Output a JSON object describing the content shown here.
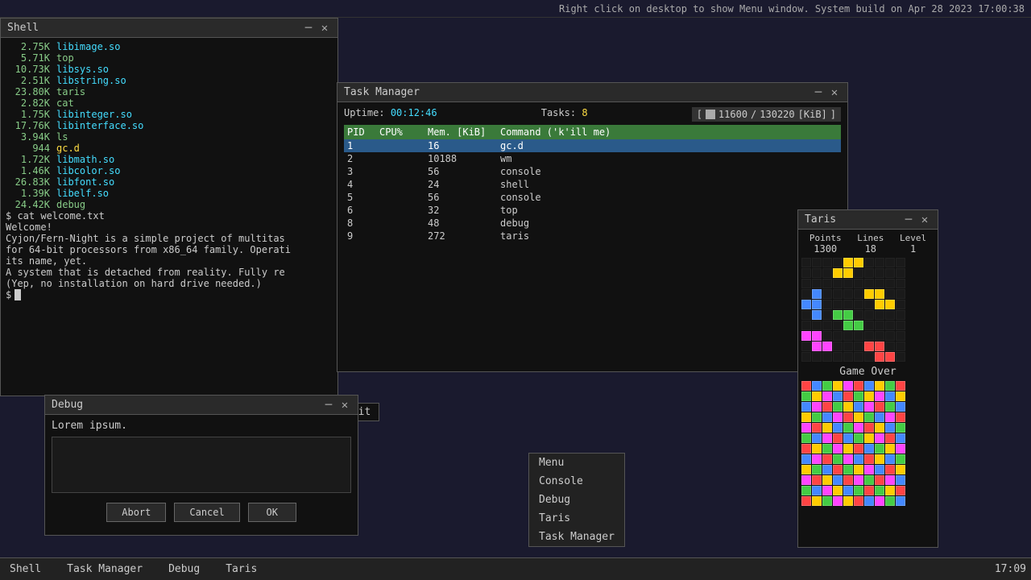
{
  "topbar": {
    "text": "Right click on desktop to show Menu window.  System build on Apr 28 2023 17:00:38"
  },
  "shell": {
    "title": "Shell",
    "lines": [
      {
        "size": "2.75K",
        "file": "libimage.so",
        "color": "cyan"
      },
      {
        "size": "5.71K",
        "file": "top",
        "color": "green"
      },
      {
        "size": "10.73K",
        "file": "libsys.so",
        "color": "cyan"
      },
      {
        "size": "2.51K",
        "file": "libstring.so",
        "color": "cyan"
      },
      {
        "size": "23.80K",
        "file": "taris",
        "color": "green"
      },
      {
        "size": "2.82K",
        "file": "cat",
        "color": "green"
      },
      {
        "size": "1.75K",
        "file": "libinteger.so",
        "color": "cyan"
      },
      {
        "size": "17.76K",
        "file": "libinterface.so",
        "color": "cyan"
      },
      {
        "size": "3.94K",
        "file": "ls",
        "color": "green"
      },
      {
        "size": "944",
        "file": "gc.d",
        "color": "yellow"
      },
      {
        "size": "1.72K",
        "file": "libmath.so",
        "color": "cyan"
      },
      {
        "size": "1.46K",
        "file": "libcolor.so",
        "color": "cyan"
      },
      {
        "size": "26.83K",
        "file": "libfont.so",
        "color": "cyan"
      },
      {
        "size": "1.39K",
        "file": "libelf.so",
        "color": "cyan"
      },
      {
        "size": "24.42K",
        "file": "debug",
        "color": "green"
      }
    ],
    "cmd1": "$ cat welcome.txt",
    "welcome": "Welcome!",
    "para1": "  Cyjon/Fern-Night is a simple project of multitas",
    "para2": "for 64-bit processors from x86_64 family. Operati",
    "para3": "its name, yet.",
    "para4": "  A system that is detached from reality. Fully re",
    "para5": "(Yep, no installation on hard drive needed.)",
    "prompt": "$ "
  },
  "taskmanager": {
    "title": "Task Manager",
    "uptime_label": "Uptime:",
    "uptime_val": "00:12:46",
    "tasks_label": "Tasks:",
    "tasks_val": "8",
    "mem_used": "11600",
    "mem_total": "130220",
    "mem_unit": "[KiB]",
    "header": [
      "PID",
      "CPU%",
      "Mem. [KiB]",
      "Command ('k'ill me)"
    ],
    "processes": [
      {
        "pid": "1",
        "cpu": "",
        "mem": "16",
        "cmd": "gc.d",
        "selected": true
      },
      {
        "pid": "2",
        "cpu": "",
        "mem": "10188",
        "cmd": "wm",
        "selected": false
      },
      {
        "pid": "3",
        "cpu": "",
        "mem": "56",
        "cmd": "console",
        "selected": false
      },
      {
        "pid": "4",
        "cpu": "",
        "mem": "24",
        "cmd": "shell",
        "selected": false
      },
      {
        "pid": "5",
        "cpu": "",
        "mem": "56",
        "cmd": "console",
        "selected": false
      },
      {
        "pid": "6",
        "cpu": "",
        "mem": "32",
        "cmd": "top",
        "selected": false
      },
      {
        "pid": "8",
        "cpu": "",
        "mem": "48",
        "cmd": "debug",
        "selected": false
      },
      {
        "pid": "9",
        "cpu": "",
        "mem": "272",
        "cmd": "taris",
        "selected": false
      }
    ]
  },
  "debug": {
    "title": "Debug",
    "text": "Lorem ipsum.",
    "textarea": "",
    "btn_abort": "Abort",
    "btn_cancel": "Cancel",
    "btn_ok": "OK"
  },
  "taris": {
    "title": "Taris",
    "points_label": "Points",
    "points_val": "1300",
    "lines_label": "Lines",
    "lines_val": "18",
    "level_label": "Level",
    "level_val": "1",
    "game_over": "Game Over"
  },
  "context_menu": {
    "items": [
      "Menu",
      "Console",
      "Debug",
      "Taris",
      "Task Manager"
    ]
  },
  "quit": {
    "label": "Quit"
  },
  "taskbar": {
    "items": [
      "Shell",
      "Task Manager",
      "Debug",
      "Taris"
    ],
    "time": "17:09"
  }
}
